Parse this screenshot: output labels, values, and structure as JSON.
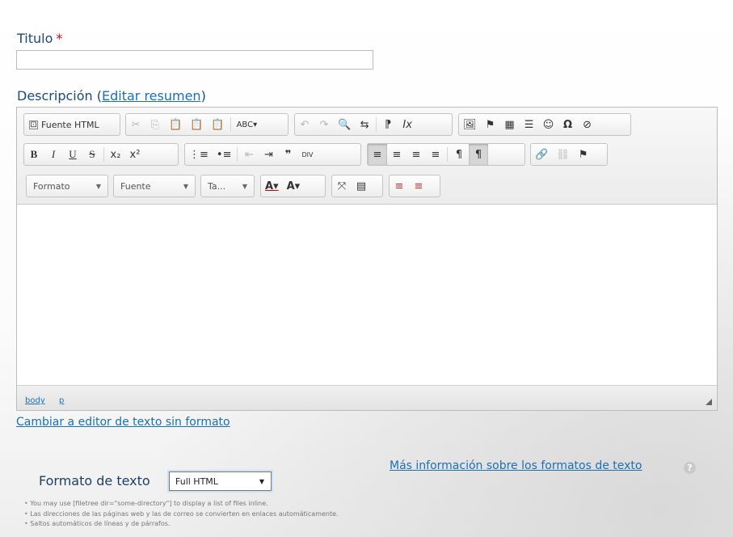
{
  "form": {
    "title_label": "Titulo",
    "required_mark": "*",
    "title_value": "",
    "description_label": "Descripción (",
    "edit_summary_link": "Editar resumen",
    "description_label_end": ")"
  },
  "toolbar": {
    "row1": {
      "source": "Fuente HTML",
      "group2": [
        "✂",
        "⎘",
        "📋",
        "📋",
        "📋",
        "ABC▾"
      ],
      "group3": [
        "↶",
        "↷",
        "🔍",
        "⇆",
        "⁋",
        "Ix"
      ],
      "group4": [
        "🖼",
        "⚑",
        "▦",
        "☰",
        "☺",
        "Ω",
        "⊘"
      ]
    },
    "row2": {
      "group1": [
        "B",
        "I",
        "U",
        "S",
        "x₂",
        "x²"
      ],
      "group2": [
        "⋮≡",
        "•≡",
        "⇤",
        "⇥",
        "❞",
        "DIV"
      ],
      "group3": [
        "≡",
        "≡",
        "≡",
        "≡",
        "¶",
        "¶"
      ],
      "group4": [
        "🔗",
        "⛓",
        "⚑"
      ]
    },
    "row3": {
      "combo_format": "Formato",
      "combo_font": "Fuente",
      "combo_size": "Ta...",
      "text_color": "A▾",
      "bg_color": "A▾",
      "maximize": "⤧",
      "blocks": "▤",
      "misc": [
        "≡",
        "≡"
      ]
    }
  },
  "editor": {
    "content": "",
    "path": [
      "body",
      "p"
    ]
  },
  "links": {
    "switch_editor": "Cambiar a editor de texto sin formato",
    "more_info": "Más información sobre los formatos de texto"
  },
  "text_format": {
    "label": "Formato de texto",
    "selected": "Full HTML"
  },
  "tips": [
    "You may use [filetree dir=\"some-directory\"] to display a list of files inline.",
    "Las direcciones de las páginas web y las de correo se convierten en enlaces automáticamente.",
    "Saltos automáticos de líneas y de párrafos."
  ],
  "colors": {
    "label": "#1c4a7a",
    "link": "#1c6fb5",
    "required": "#e00000"
  }
}
